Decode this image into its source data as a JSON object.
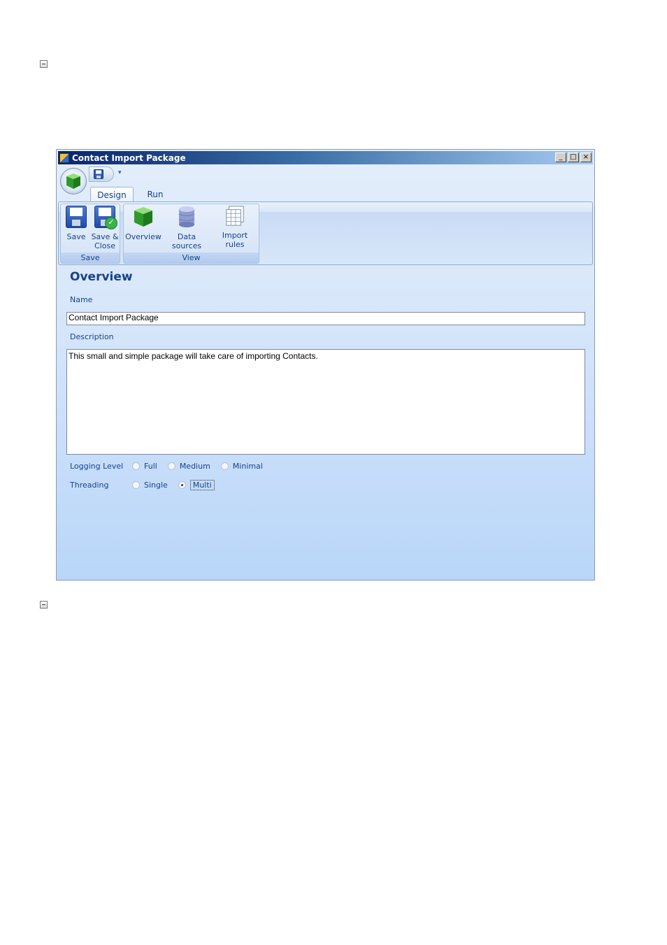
{
  "window": {
    "title": "Contact Import Package",
    "controls": {
      "minimize": "_",
      "maximize": "□",
      "close": "×"
    }
  },
  "tabs": [
    {
      "label": "Design",
      "active": true
    },
    {
      "label": "Run",
      "active": false
    }
  ],
  "ribbon": {
    "groups": [
      {
        "label": "Save",
        "buttons": [
          {
            "label": "Save",
            "icon": "floppy-save-icon"
          },
          {
            "label": "Save &\nClose",
            "icon": "floppy-check-icon"
          }
        ]
      },
      {
        "label": "View",
        "buttons": [
          {
            "label": "Overview",
            "icon": "green-cube-icon"
          },
          {
            "label": "Data sources",
            "icon": "database-icon"
          },
          {
            "label": "Import rules",
            "icon": "grid-icon"
          }
        ]
      }
    ]
  },
  "overview": {
    "heading": "Overview",
    "name_label": "Name",
    "name_value": "Contact Import Package",
    "description_label": "Description",
    "description_value": "This small and simple package will take care of importing Contacts.",
    "logging": {
      "label": "Logging Level",
      "options": [
        "Full",
        "Medium",
        "Minimal"
      ],
      "selected": null
    },
    "threading": {
      "label": "Threading",
      "options": [
        "Single",
        "Multi"
      ],
      "selected": "Multi"
    }
  },
  "colors": {
    "accent": "#15428b",
    "title_bar_start": "#0a246a",
    "title_bar_end": "#a6caf0"
  }
}
